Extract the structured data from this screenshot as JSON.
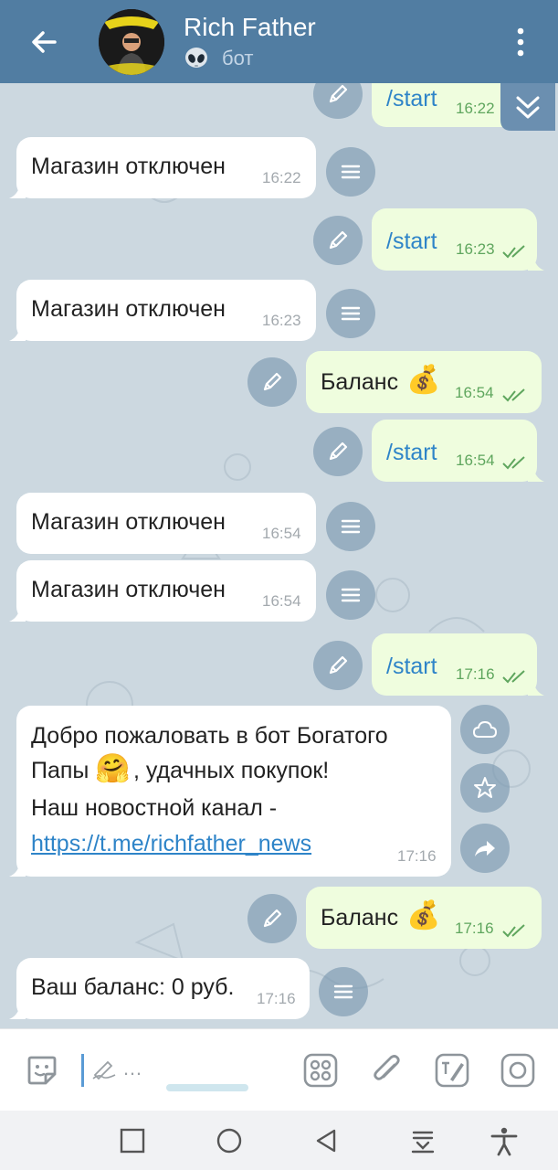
{
  "header": {
    "title": "Rich Father",
    "subtitle": "бот",
    "bot_badge_icon": "alien-icon",
    "accent_color": "#517da2"
  },
  "messages": [
    {
      "dir": "out",
      "text": "/start",
      "time": "16:22",
      "read": true
    },
    {
      "dir": "in",
      "text": "Магазин отключен",
      "time": "16:22"
    },
    {
      "dir": "out",
      "text": "/start",
      "time": "16:23",
      "read": true
    },
    {
      "dir": "in",
      "text": "Магазин отключен",
      "time": "16:23"
    },
    {
      "dir": "out",
      "text": "Баланс",
      "emoji": "💰",
      "time": "16:54",
      "read": true
    },
    {
      "dir": "out",
      "text": "/start",
      "time": "16:54",
      "read": true
    },
    {
      "dir": "in",
      "text": "Магазин отключен",
      "time": "16:54"
    },
    {
      "dir": "in",
      "text": "Магазин отключен",
      "time": "16:54"
    },
    {
      "dir": "out",
      "text": "/start",
      "time": "17:16",
      "read": true
    },
    {
      "dir": "in",
      "lines": [
        "Добро пожаловать в бот Богатого",
        "Папы",
        ", удачных покупок!",
        "Наш новостной канал -",
        "https://t.me/richfather_news"
      ],
      "emoji": "🤗",
      "time": "17:16"
    },
    {
      "dir": "out",
      "text": "Баланс",
      "emoji": "💰",
      "time": "17:16",
      "read": true
    },
    {
      "dir": "in",
      "text": "Ваш баланс: 0 руб.",
      "time": "17:16"
    }
  ],
  "input": {
    "placeholder": "…"
  },
  "colors": {
    "outgoing_bubble": "#effdde",
    "incoming_bubble": "#ffffff",
    "command_link": "#2e84c8",
    "read_check": "#5fa65e"
  }
}
